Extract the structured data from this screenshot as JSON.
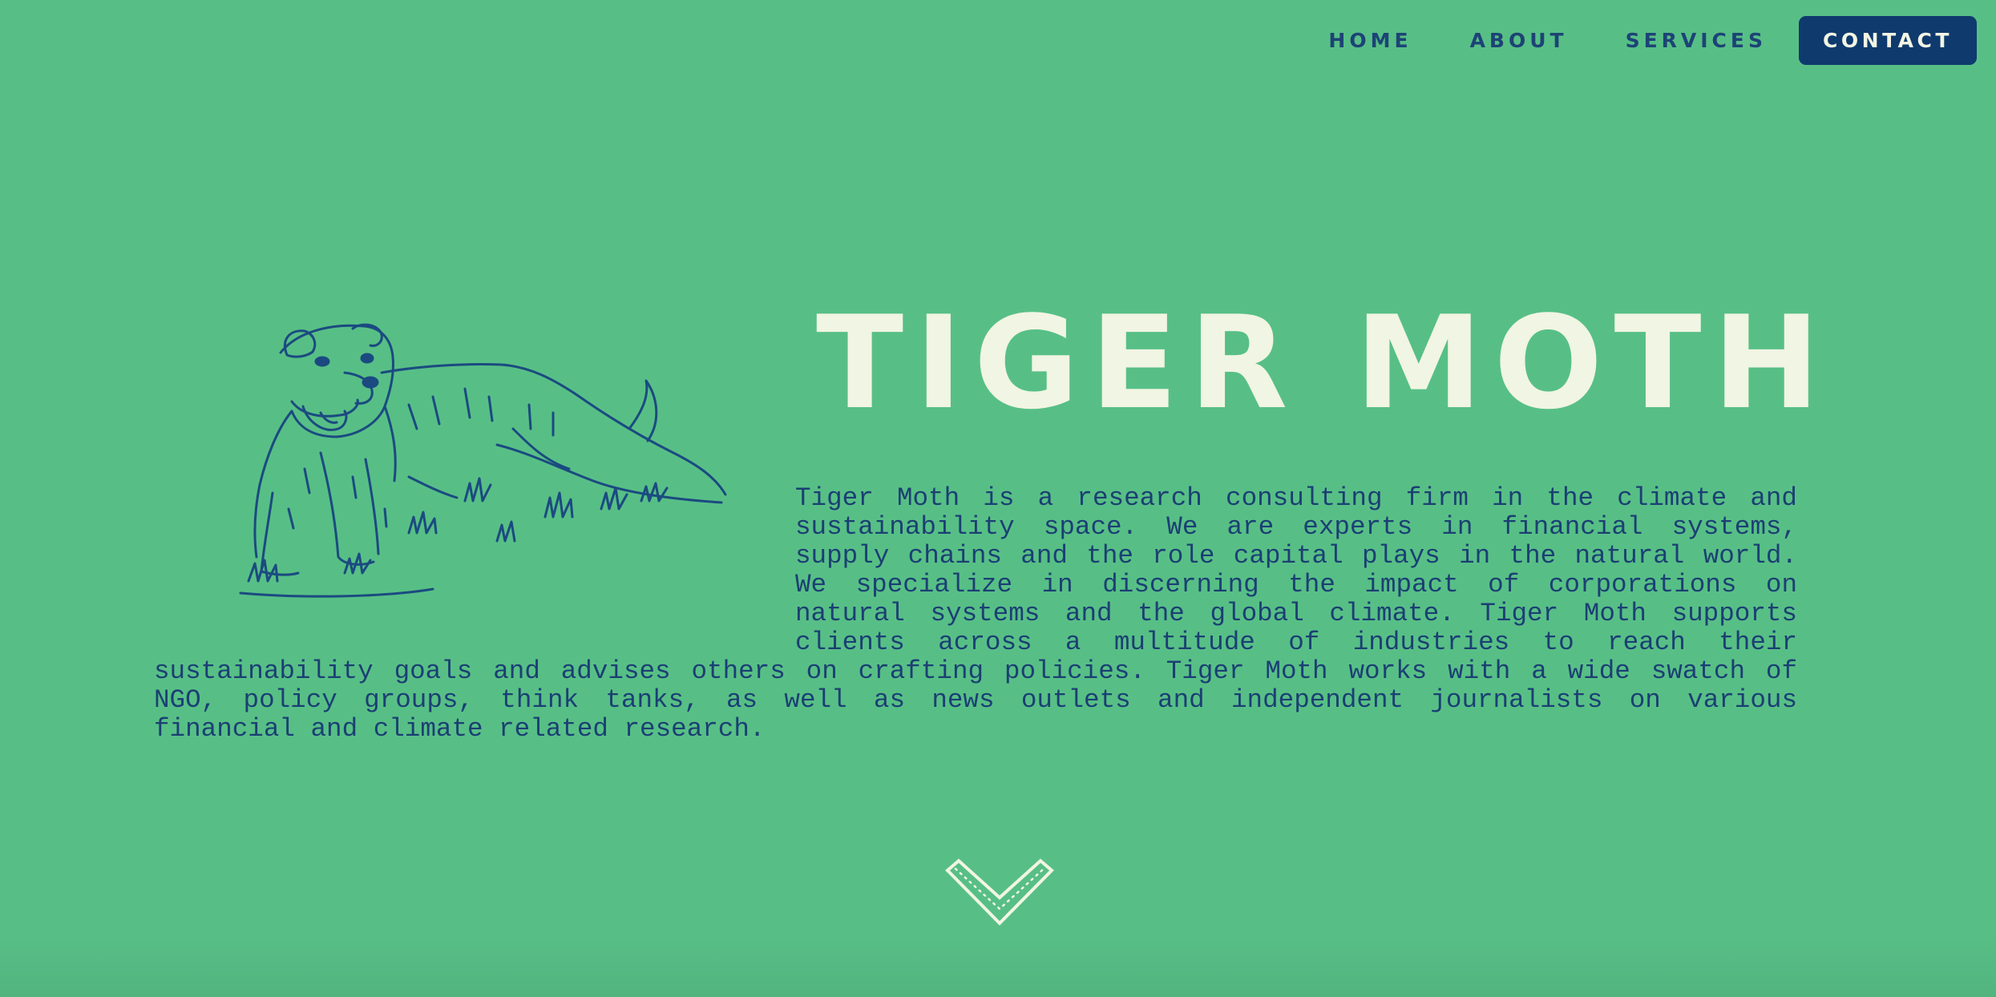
{
  "nav": {
    "items": [
      {
        "label": "HOME"
      },
      {
        "label": "ABOUT"
      },
      {
        "label": "SERVICES"
      }
    ],
    "contact_label": "CONTACT"
  },
  "hero": {
    "title": "TIGER MOTH",
    "description": "Tiger Moth is a research consulting firm in the climate and sustainability space. We are experts in financial systems, supply chains and the role capital plays in the natural world. We specialize in discerning the impact of corporations on natural systems and the global climate. Tiger Moth supports clients across a multitude of industries to reach their sustainability goals and advises others on crafting policies. Tiger Moth works with a wide swatch of NGO, policy groups, think tanks, as well as news outlets and independent journalists on various financial and climate related research.",
    "illustration": "dog-illustration",
    "scroll_icon": "chevron-down-icon"
  },
  "colors": {
    "background": "#57bf86",
    "navy": "#0f3a6e",
    "nav_text": "#1d4376",
    "title": "#f1f5e3"
  }
}
